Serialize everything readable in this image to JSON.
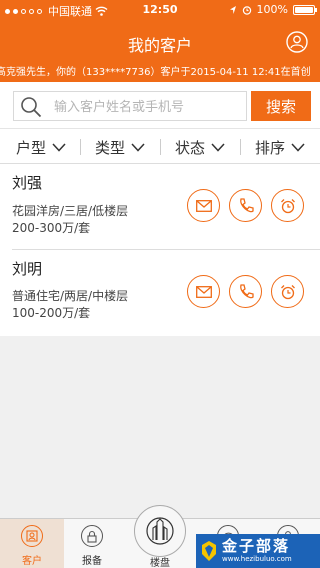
{
  "status_bar": {
    "carrier": "中国联通",
    "time": "12:50",
    "battery": "100%"
  },
  "header": {
    "title": "我的客户"
  },
  "notice": {
    "text": "高克强先生，你的（133****7736）客户于2015-04-11 12:41在首创"
  },
  "search": {
    "placeholder": "输入客户姓名或手机号",
    "button_label": "搜索"
  },
  "filters": [
    {
      "label": "户型"
    },
    {
      "label": "类型"
    },
    {
      "label": "状态"
    },
    {
      "label": "排序"
    }
  ],
  "customers": [
    {
      "name": "刘强",
      "detail": "花园洋房/三居/低楼层",
      "budget": "200-300万/套"
    },
    {
      "name": "刘明",
      "detail": "普通住宅/两居/中楼层",
      "budget": "100-200万/套"
    }
  ],
  "tabs": [
    {
      "label": "客户",
      "icon": "customer-icon",
      "active": true
    },
    {
      "label": "报备",
      "icon": "lock-icon"
    },
    {
      "label": "楼盘",
      "icon": "buildings-icon"
    },
    {
      "label": "",
      "icon": "eye-icon"
    },
    {
      "label": "",
      "icon": "person-icon"
    }
  ],
  "watermark": {
    "text": "金子部落",
    "url": "www.hezibuluo.com"
  },
  "colors": {
    "accent": "#f06b17",
    "watermark_blue": "#1c63b7"
  }
}
